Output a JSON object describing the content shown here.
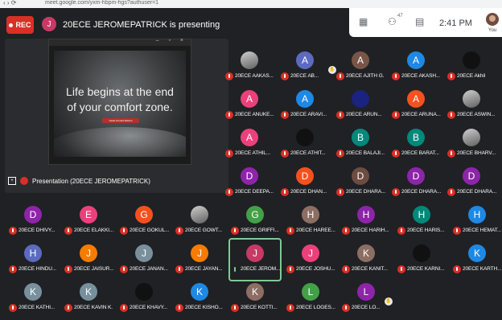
{
  "browser": {
    "url": "meet.google.com/yxm-hbpm-hgs?authuser=1"
  },
  "header": {
    "rec_label": "REC",
    "presenter_initial": "J",
    "presenter_color": "#c73a65",
    "presenting_text": "20ECE JEROMEPATRICK is presenting"
  },
  "panel": {
    "participants_count": "47",
    "time": "2:41 PM",
    "you_label": "You"
  },
  "presentation": {
    "quote_line1": "Life begins at the end",
    "quote_line2": "of your comfort zone.",
    "author": "Neale Donald Walsch",
    "caption": "Presentation (20ECE JEROMEPATRICK)"
  },
  "participants": [
    {
      "name": "20ECE AAKAS...",
      "initial": "",
      "color": "photo"
    },
    {
      "name": "20ECE AB...",
      "initial": "A",
      "color": "#5c6bc0"
    },
    {
      "name": "20ECE AJITH G.",
      "initial": "A",
      "color": "#795548"
    },
    {
      "name": "20ECE AKASH...",
      "initial": "A",
      "color": "#1e88e5"
    },
    {
      "name": "20ECE Akhil",
      "initial": "",
      "color": "dark"
    },
    {
      "name": "20ECE ANUKE...",
      "initial": "A",
      "color": "#ec407a"
    },
    {
      "name": "20ECE ARAVI...",
      "initial": "A",
      "color": "#1e88e5"
    },
    {
      "name": "20ECE ARUN...",
      "initial": "",
      "color": "#1a237e"
    },
    {
      "name": "20ECE ARUNA...",
      "initial": "A",
      "color": "#f4511e"
    },
    {
      "name": "20ECE ASWIN...",
      "initial": "",
      "color": "photo"
    },
    {
      "name": "20ECE ATHIL...",
      "initial": "A",
      "color": "#ec407a"
    },
    {
      "name": "20ECE ATHIT...",
      "initial": "",
      "color": "dark"
    },
    {
      "name": "20ECE BALAJI...",
      "initial": "B",
      "color": "#00897b"
    },
    {
      "name": "20ECE BARAT...",
      "initial": "B",
      "color": "#00897b"
    },
    {
      "name": "20ECE BHARV...",
      "initial": "",
      "color": "photo"
    },
    {
      "name": "20ECE DEEPA...",
      "initial": "D",
      "color": "#8e24aa"
    },
    {
      "name": "20ECE DHAN...",
      "initial": "D",
      "color": "#f4511e"
    },
    {
      "name": "20ECE DHARA...",
      "initial": "D",
      "color": "#6d4c41"
    },
    {
      "name": "20ECE DHARA...",
      "initial": "D",
      "color": "#8e24aa"
    },
    {
      "name": "20ECE DHARA...",
      "initial": "D",
      "color": "#8e24aa"
    },
    {
      "name": "20ECE DHIVY...",
      "initial": "D",
      "color": "#8e24aa"
    },
    {
      "name": "20ECE ELAKKI...",
      "initial": "E",
      "color": "#ec407a"
    },
    {
      "name": "20ECE GOKUL...",
      "initial": "G",
      "color": "#f4511e"
    },
    {
      "name": "20ECE GOWT...",
      "initial": "",
      "color": "photo"
    },
    {
      "name": "20ECE GRIFFI...",
      "initial": "G",
      "color": "#43a047"
    },
    {
      "name": "20ECE HAREE...",
      "initial": "H",
      "color": "#8d6e63"
    },
    {
      "name": "20ECE HARIH...",
      "initial": "H",
      "color": "#8e24aa"
    },
    {
      "name": "20ECE HARIS...",
      "initial": "H",
      "color": "#00897b"
    },
    {
      "name": "20ECE HEMAT...",
      "initial": "H",
      "color": "#1e88e5"
    },
    {
      "name": "20ECE HINDU...",
      "initial": "H",
      "color": "#5c6bc0"
    },
    {
      "name": "20ECE JAISUR...",
      "initial": "J",
      "color": "#f57c00"
    },
    {
      "name": "20ECE JANAN...",
      "initial": "J",
      "color": "#78909c"
    },
    {
      "name": "20ECE JAYAN...",
      "initial": "J",
      "color": "#f57c00"
    },
    {
      "name": "20ECE JEROM...",
      "initial": "J",
      "color": "#c73a65"
    },
    {
      "name": "20ECE JOSHU...",
      "initial": "J",
      "color": "#ec407a"
    },
    {
      "name": "20ECE KANIT...",
      "initial": "K",
      "color": "#8d6e63"
    },
    {
      "name": "20ECE KARNI...",
      "initial": "",
      "color": "dark"
    },
    {
      "name": "20ECE KARTH...",
      "initial": "K",
      "color": "#1e88e5"
    },
    {
      "name": "20ECE KATHI...",
      "initial": "K",
      "color": "#78909c"
    },
    {
      "name": "20ECE KAVIN K.",
      "initial": "K",
      "color": "#78909c"
    },
    {
      "name": "20ECE KHAVY...",
      "initial": "",
      "color": "dark"
    },
    {
      "name": "20ECE KISHO...",
      "initial": "K",
      "color": "#1e88e5"
    },
    {
      "name": "20ECE KOTTI...",
      "initial": "K",
      "color": "#8d6e63"
    },
    {
      "name": "20ECE LOGES...",
      "initial": "L",
      "color": "#43a047"
    },
    {
      "name": "20ECE LO...",
      "initial": "L",
      "color": "#8e24aa"
    }
  ]
}
